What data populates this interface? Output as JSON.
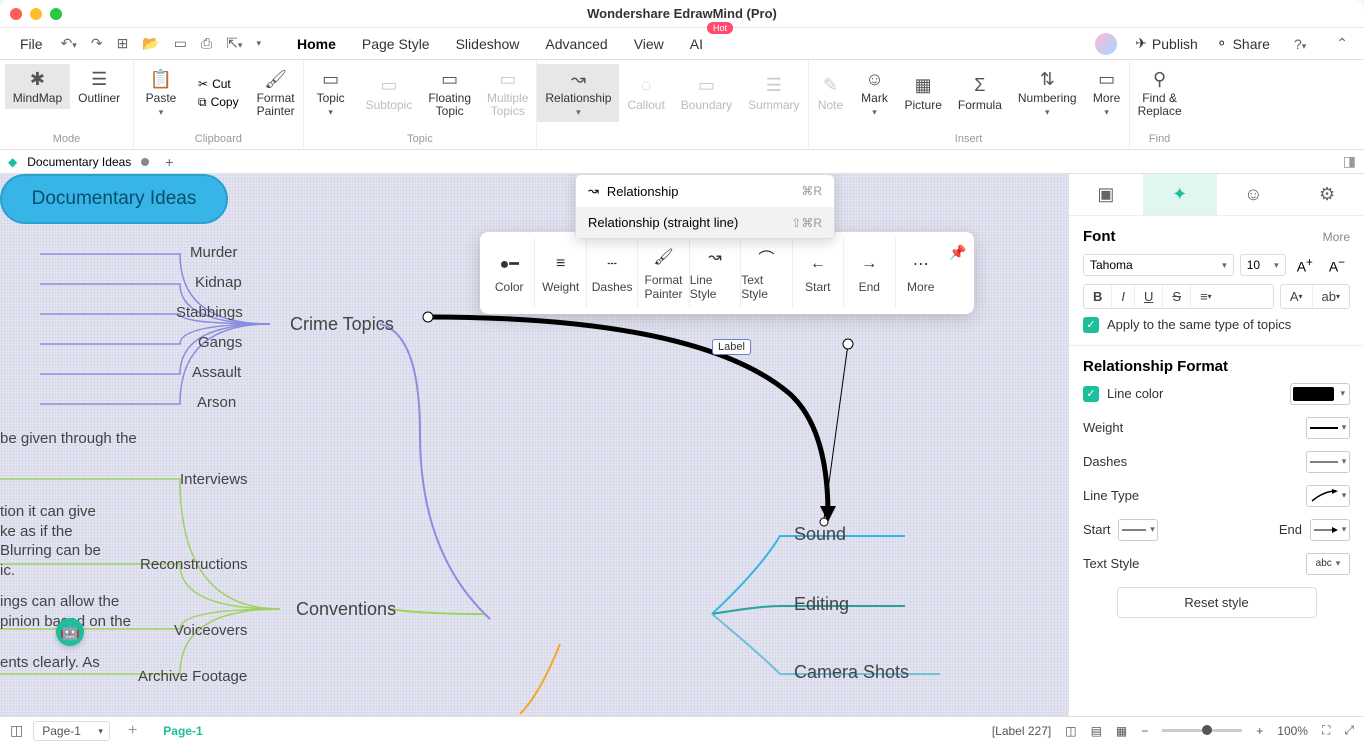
{
  "window": {
    "title": "Wondershare EdrawMind (Pro)"
  },
  "menubar": {
    "file": "File",
    "tabs": [
      "Home",
      "Page Style",
      "Slideshow",
      "Advanced",
      "View",
      "AI"
    ],
    "activeTab": "Home",
    "hot_badge": "Hot",
    "publish": "Publish",
    "share": "Share"
  },
  "ribbon": {
    "groups": {
      "mode": {
        "label": "Mode",
        "items": [
          {
            "id": "mindmap",
            "label": "MindMap",
            "active": true
          },
          {
            "id": "outliner",
            "label": "Outliner"
          }
        ]
      },
      "clipboard": {
        "label": "Clipboard",
        "paste": "Paste",
        "cut": "Cut",
        "copy": "Copy",
        "format_painter": "Format\nPainter"
      },
      "topic": {
        "label": "Topic",
        "items": [
          {
            "id": "topic",
            "label": "Topic"
          },
          {
            "id": "subtopic",
            "label": "Subtopic",
            "disabled": true
          },
          {
            "id": "floating",
            "label": "Floating\nTopic"
          },
          {
            "id": "multiple",
            "label": "Multiple\nTopics",
            "disabled": true
          }
        ]
      },
      "relgroup": {
        "items": [
          {
            "id": "relationship",
            "label": "Relationship",
            "active": true
          },
          {
            "id": "callout",
            "label": "Callout",
            "disabled": true
          },
          {
            "id": "boundary",
            "label": "Boundary",
            "disabled": true
          },
          {
            "id": "summary",
            "label": "Summary",
            "disabled": true
          }
        ]
      },
      "insert": {
        "label": "Insert",
        "items": [
          {
            "id": "note",
            "label": "Note",
            "disabled": true
          },
          {
            "id": "mark",
            "label": "Mark"
          },
          {
            "id": "picture",
            "label": "Picture"
          },
          {
            "id": "formula",
            "label": "Formula"
          },
          {
            "id": "numbering",
            "label": "Numbering"
          },
          {
            "id": "more",
            "label": "More"
          }
        ]
      },
      "find": {
        "label": "Find",
        "item": {
          "id": "findreplace",
          "label": "Find &\nReplace"
        }
      }
    }
  },
  "dropdown": {
    "items": [
      {
        "label": "Relationship",
        "shortcut": "⌘R"
      },
      {
        "label": "Relationship (straight line)",
        "shortcut": "⇧⌘R",
        "hover": true
      }
    ]
  },
  "tabs": {
    "doc_name": "Documentary Ideas"
  },
  "canvas": {
    "center": "Documentary Ideas",
    "crime": {
      "label": "Crime Topics",
      "children": [
        "Murder",
        "Kidnap",
        "Stabbings",
        "Gangs",
        "Assault",
        "Arson"
      ]
    },
    "conventions": {
      "label": "Conventions",
      "children": [
        "Interviews",
        "Reconstructions",
        "Voiceovers",
        "Archive Footage"
      ],
      "partial": [
        "be given through the",
        "tion it can give\nke as if the\nBlurring can be\nic.",
        "ings can allow the\npinion based on the",
        "ents clearly. As"
      ]
    },
    "right_topics": [
      "Sound",
      "Editing",
      "Camera Shots"
    ],
    "rel_label": "Label"
  },
  "float_toolbar": {
    "items": [
      "Color",
      "Weight",
      "Dashes",
      "Format\nPainter",
      "Line Style",
      "Text Style",
      "Start",
      "End",
      "More"
    ]
  },
  "sidepanel": {
    "font": {
      "title": "Font",
      "more": "More",
      "family": "Tahoma",
      "size": "10",
      "apply_same": "Apply to the same type of topics"
    },
    "rel": {
      "title": "Relationship Format",
      "line_color": "Line color",
      "weight": "Weight",
      "dashes": "Dashes",
      "line_type": "Line Type",
      "start": "Start",
      "end": "End",
      "text_style": "Text Style",
      "reset": "Reset style"
    }
  },
  "status": {
    "page_sel": "Page-1",
    "page_active": "Page-1",
    "label_info": "[Label 227]",
    "zoom": "100%"
  }
}
